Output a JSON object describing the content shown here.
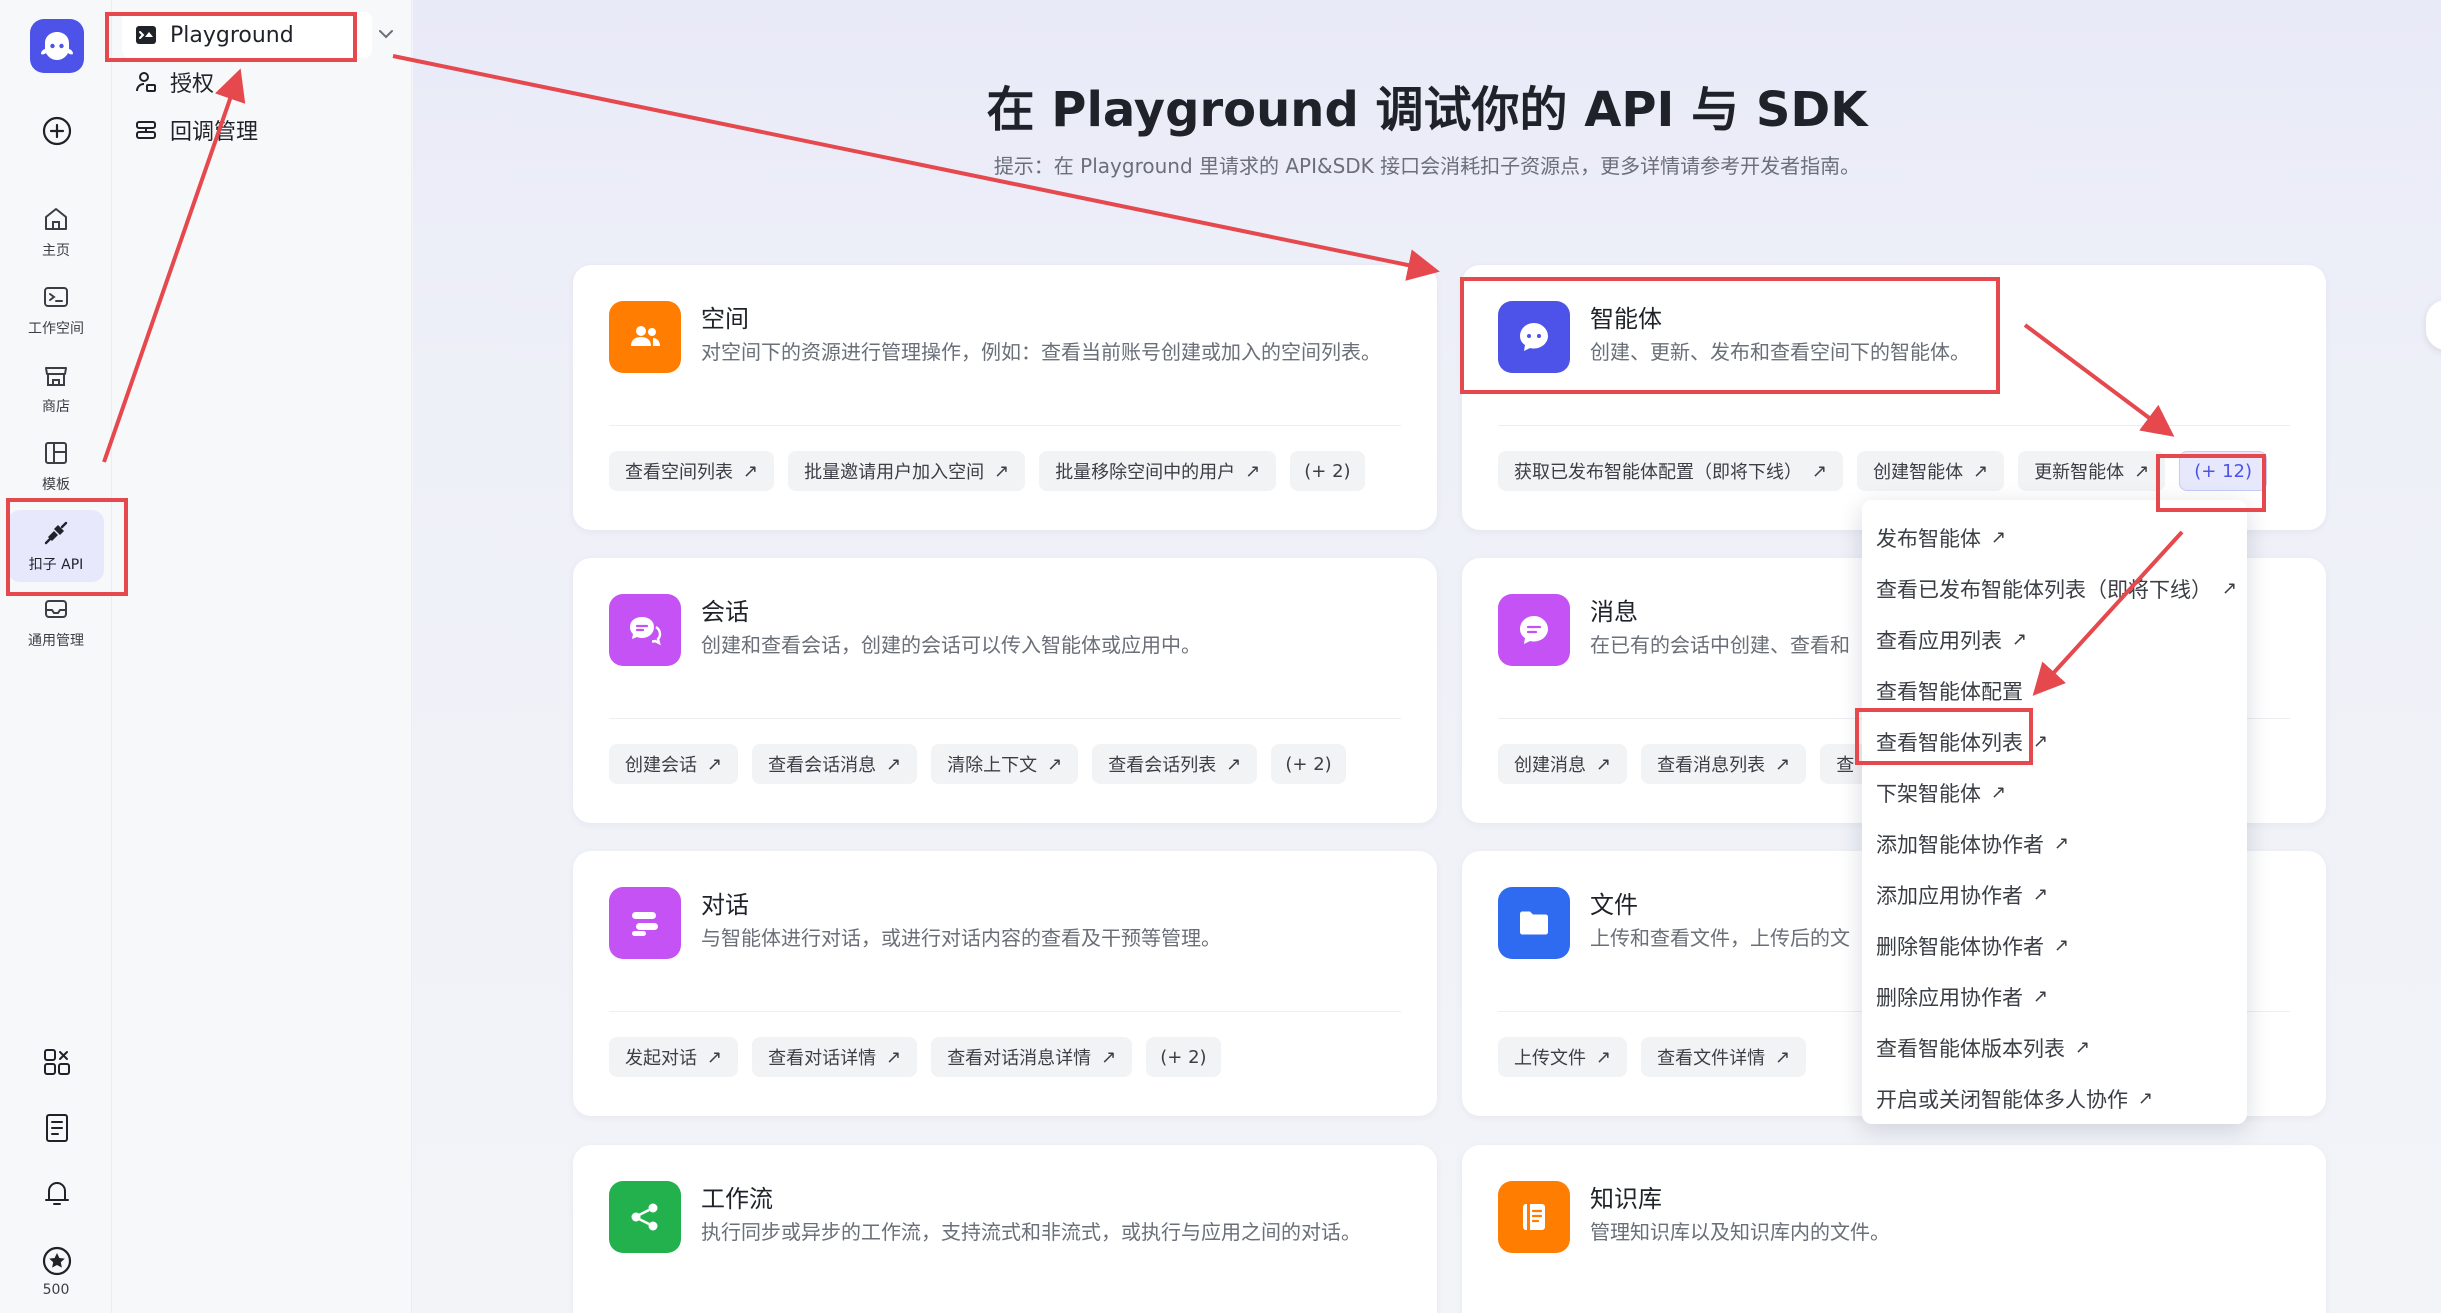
{
  "rail": {
    "items": [
      {
        "label": "主页",
        "icon": "home-icon"
      },
      {
        "label": "工作空间",
        "icon": "terminal-icon"
      },
      {
        "label": "商店",
        "icon": "store-icon"
      },
      {
        "label": "模板",
        "icon": "template-icon"
      },
      {
        "label": "扣子 API",
        "icon": "plug-icon"
      },
      {
        "label": "通用管理",
        "icon": "inbox-icon"
      }
    ],
    "credits": "500"
  },
  "subnav": {
    "items": [
      {
        "label": "Playground",
        "icon": "playground-icon"
      },
      {
        "label": "授权",
        "icon": "auth-icon"
      },
      {
        "label": "回调管理",
        "icon": "callback-icon"
      }
    ]
  },
  "main": {
    "title": "在 Playground 调试你的 API 与 SDK",
    "tip": "提示：在 Playground 里请求的 API&SDK 接口会消耗扣子资源点，更多详情请参考开发者指南。"
  },
  "cards": [
    {
      "title": "空间",
      "desc": "对空间下的资源进行管理操作，例如：查看当前账号创建或加入的空间列表。",
      "tags": [
        "查看空间列表",
        "批量邀请用户加入空间",
        "批量移除空间中的用户"
      ],
      "more": "(+ 2)",
      "color": "#ff7d00"
    },
    {
      "title": "智能体",
      "desc": "创建、更新、发布和查看空间下的智能体。",
      "tags": [
        "获取已发布智能体配置（即将下线）",
        "创建智能体",
        "更新智能体"
      ],
      "more": "(+ 12)",
      "color": "#4d53e8"
    },
    {
      "title": "会话",
      "desc": "创建和查看会话，创建的会话可以传入智能体或应用中。",
      "tags": [
        "创建会话",
        "查看会话消息",
        "清除上下文",
        "查看会话列表"
      ],
      "more": "(+ 2)",
      "color": "#c552f5"
    },
    {
      "title": "消息",
      "desc": "在已有的会话中创建、查看和",
      "tags": [
        "创建消息",
        "查看消息列表",
        "查"
      ],
      "more": "",
      "color": "#c552f5"
    },
    {
      "title": "对话",
      "desc": "与智能体进行对话，或进行对话内容的查看及干预等管理。",
      "tags": [
        "发起对话",
        "查看对话详情",
        "查看对话消息详情"
      ],
      "more": "(+ 2)",
      "color": "#c552f5"
    },
    {
      "title": "文件",
      "desc": "上传和查看文件，上传后的文",
      "tags": [
        "上传文件",
        "查看文件详情"
      ],
      "more": "",
      "color": "#2f6bf0"
    },
    {
      "title": "工作流",
      "desc": "执行同步或异步的工作流，支持流式和非流式，或执行与应用之间的对话。",
      "tags": [],
      "more": "",
      "color": "#22b14c"
    },
    {
      "title": "知识库",
      "desc": "管理知识库以及知识库内的文件。",
      "tags": [],
      "more": "",
      "color": "#ff7d00"
    }
  ],
  "dropdown": {
    "items": [
      "发布智能体",
      "查看已发布智能体列表（即将下线）",
      "查看应用列表",
      "查看智能体配置",
      "查看智能体列表",
      "下架智能体",
      "添加智能体协作者",
      "添加应用协作者",
      "删除智能体协作者",
      "删除应用协作者",
      "查看智能体版本列表",
      "开启或关闭智能体多人协作"
    ]
  },
  "colors": {
    "accent": "#4d53e8",
    "annotation": "#e5484d"
  }
}
